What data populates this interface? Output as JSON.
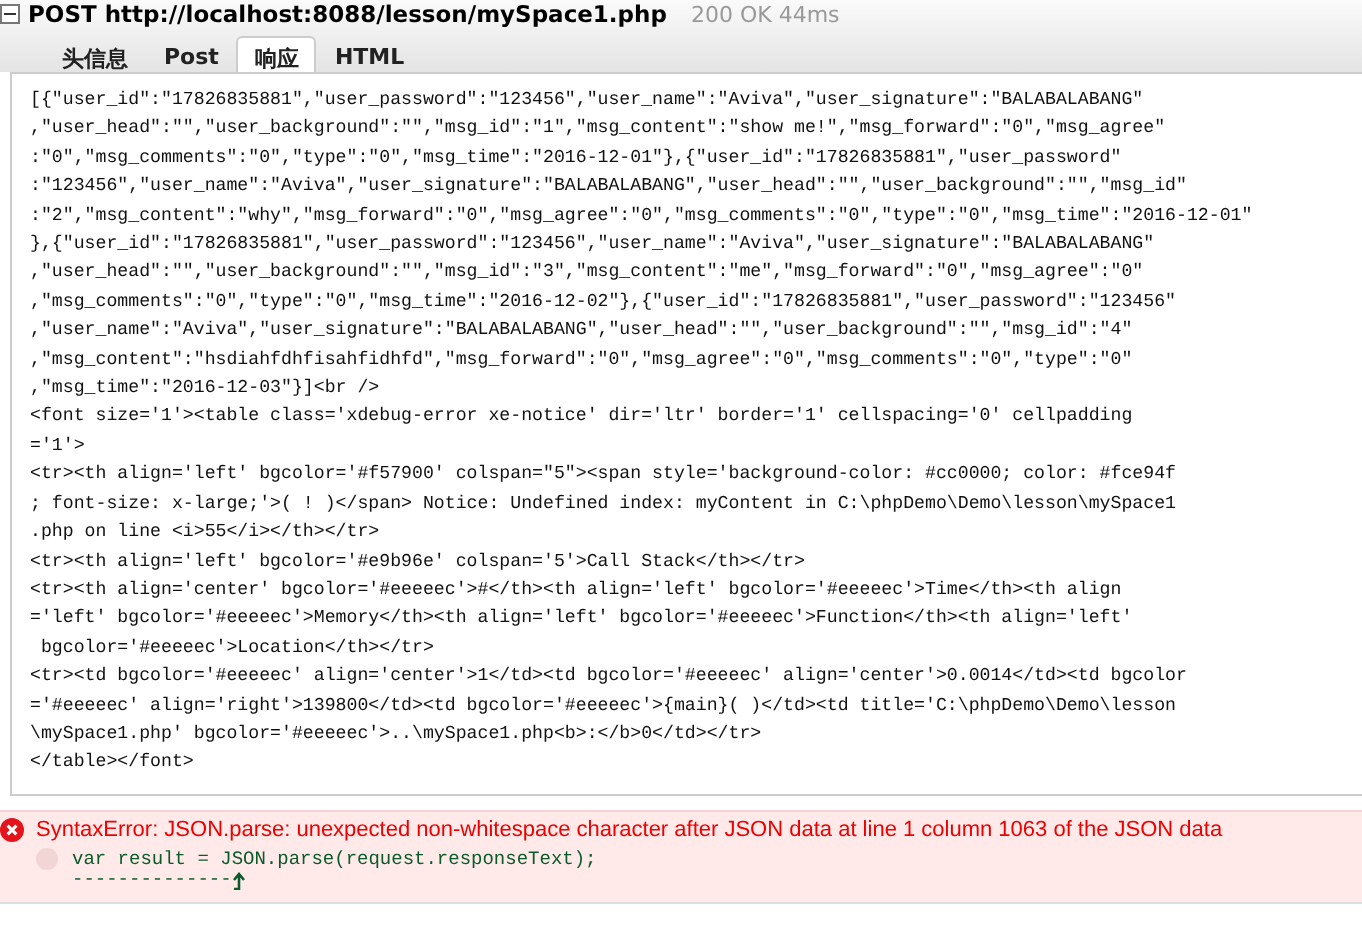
{
  "request": {
    "method_url": "POST http://localhost:8088/lesson/mySpace1.php",
    "status": "200 OK 44ms",
    "expanded": true
  },
  "tabs": [
    {
      "label": "头信息",
      "selected": false
    },
    {
      "label": "Post",
      "selected": false
    },
    {
      "label": "响应",
      "selected": true
    },
    {
      "label": "HTML",
      "selected": false
    }
  ],
  "response_lines": [
    "[{\"user_id\":\"17826835881\",\"user_password\":\"123456\",\"user_name\":\"Aviva\",\"user_signature\":\"BALABALABANG\"",
    ",\"user_head\":\"\",\"user_background\":\"\",\"msg_id\":\"1\",\"msg_content\":\"show me!\",\"msg_forward\":\"0\",\"msg_agree\"",
    ":\"0\",\"msg_comments\":\"0\",\"type\":\"0\",\"msg_time\":\"2016-12-01\"},{\"user_id\":\"17826835881\",\"user_password\"",
    ":\"123456\",\"user_name\":\"Aviva\",\"user_signature\":\"BALABALABANG\",\"user_head\":\"\",\"user_background\":\"\",\"msg_id\"",
    ":\"2\",\"msg_content\":\"why\",\"msg_forward\":\"0\",\"msg_agree\":\"0\",\"msg_comments\":\"0\",\"type\":\"0\",\"msg_time\":\"2016-12-01\"",
    "},{\"user_id\":\"17826835881\",\"user_password\":\"123456\",\"user_name\":\"Aviva\",\"user_signature\":\"BALABALABANG\"",
    ",\"user_head\":\"\",\"user_background\":\"\",\"msg_id\":\"3\",\"msg_content\":\"me\",\"msg_forward\":\"0\",\"msg_agree\":\"0\"",
    ",\"msg_comments\":\"0\",\"type\":\"0\",\"msg_time\":\"2016-12-02\"},{\"user_id\":\"17826835881\",\"user_password\":\"123456\"",
    ",\"user_name\":\"Aviva\",\"user_signature\":\"BALABALABANG\",\"user_head\":\"\",\"user_background\":\"\",\"msg_id\":\"4\"",
    ",\"msg_content\":\"hsdiahfdhfisahfidhfd\",\"msg_forward\":\"0\",\"msg_agree\":\"0\",\"msg_comments\":\"0\",\"type\":\"0\"",
    ",\"msg_time\":\"2016-12-03\"}]<br />",
    "<font size='1'><table class='xdebug-error xe-notice' dir='ltr' border='1' cellspacing='0' cellpadding",
    "='1'>",
    "<tr><th align='left' bgcolor='#f57900' colspan=\"5\"><span style='background-color: #cc0000; color: #fce94f",
    "; font-size: x-large;'>( ! )</span> Notice: Undefined index: myContent in C:\\phpDemo\\Demo\\lesson\\mySpace1",
    ".php on line <i>55</i></th></tr>",
    "<tr><th align='left' bgcolor='#e9b96e' colspan='5'>Call Stack</th></tr>",
    "<tr><th align='center' bgcolor='#eeeeec'>#</th><th align='left' bgcolor='#eeeeec'>Time</th><th align",
    "='left' bgcolor='#eeeeec'>Memory</th><th align='left' bgcolor='#eeeeec'>Function</th><th align='left'",
    " bgcolor='#eeeeec'>Location</th></tr>",
    "<tr><td bgcolor='#eeeeec' align='center'>1</td><td bgcolor='#eeeeec' align='center'>0.0014</td><td bgcolor",
    "='#eeeeec' align='right'>139800</td><td bgcolor='#eeeeec'>{main}( )</td><td title='C:\\phpDemo\\Demo\\lesson",
    "\\mySpace1.php' bgcolor='#eeeeec'>..\\mySpace1.php<b>:</b>0</td></tr>",
    "</table></font>"
  ],
  "error": {
    "message": "SyntaxError: JSON.parse: unexpected non-whitespace character after JSON data at line 1 column 1063 of the JSON data",
    "code": "var result = JSON.parse(request.responseText);",
    "pointer": "--------------"
  }
}
